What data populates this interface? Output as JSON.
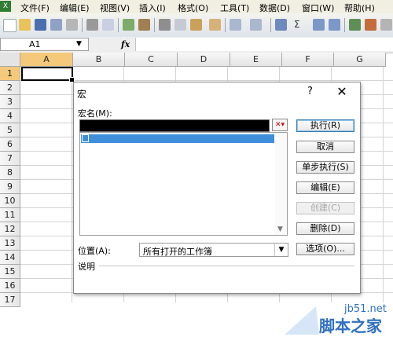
{
  "menubar": {
    "items": [
      "文件(F)",
      "编辑(E)",
      "视图(V)",
      "插入(I)",
      "格式(O)",
      "工具(T)",
      "数据(D)",
      "窗口(W)",
      "帮助(H)"
    ]
  },
  "toolbar": {
    "sum_glyph": "Σ"
  },
  "formula_bar": {
    "name_box": "A1",
    "fx_label": "fx",
    "content": ""
  },
  "grid": {
    "columns": [
      "A",
      "B",
      "C",
      "D",
      "E",
      "F",
      "G"
    ],
    "rows": [
      "1",
      "2",
      "3",
      "4",
      "5",
      "6",
      "7",
      "8",
      "9",
      "10",
      "11",
      "12",
      "13",
      "14",
      "15",
      "16",
      "17"
    ],
    "selected_cell": "A1"
  },
  "dialog": {
    "title": "宏",
    "help": "?",
    "close": "✕",
    "macro_name_label": "宏名(M):",
    "macro_name_value": "",
    "buttons": {
      "run": "执行(R)",
      "cancel": "取消",
      "step_into": "单步执行(S)",
      "edit": "编辑(E)",
      "create": "创建(C)",
      "delete": "删除(D)",
      "options": "选项(O)..."
    },
    "location_label": "位置(A):",
    "location_value": "所有打开的工作簿",
    "description_label": "说明"
  },
  "watermark": {
    "site": "jb51.net",
    "name": "脚本之家"
  },
  "colors": {
    "selection": "#3e8edc",
    "active_header": "#f5c97b",
    "watermark": "#2e6fc0"
  }
}
